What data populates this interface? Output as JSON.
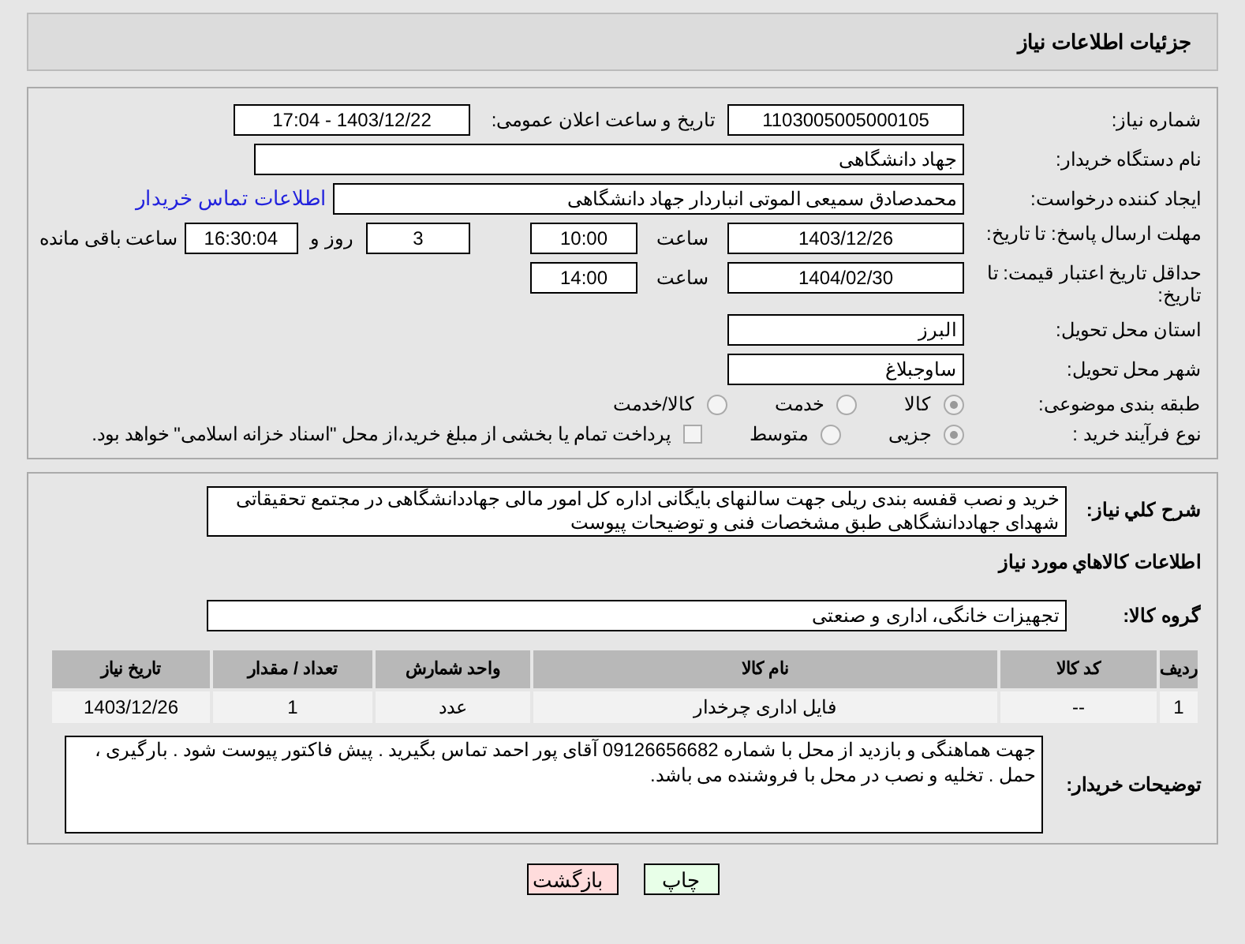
{
  "header": {
    "title": "جزئیات اطلاعات نیاز"
  },
  "need_number": {
    "label": "شماره نیاز:",
    "value": "1103005005000105"
  },
  "announce": {
    "label": "تاریخ و ساعت اعلان عمومی:",
    "value": "1403/12/22 - 17:04"
  },
  "buyer_org": {
    "label": "نام دستگاه خریدار:",
    "value": "جهاد دانشگاهی"
  },
  "requester": {
    "label": "ایجاد کننده درخواست:",
    "value": "محمدصادق سمیعی الموتی انباردار جهاد دانشگاهی",
    "link": "اطلاعات تماس خریدار"
  },
  "reply_deadline": {
    "label": "مهلت ارسال پاسخ: تا تاریخ:",
    "date": "1403/12/26",
    "time_label": "ساعت",
    "time": "10:00",
    "days": "3",
    "days_label": "روز و",
    "remaining": "16:30:04",
    "remaining_label": "ساعت باقی مانده"
  },
  "price_validity": {
    "label": "حداقل تاریخ اعتبار قیمت: تا تاریخ:",
    "date": "1404/02/30",
    "time_label": "ساعت",
    "time": "14:00"
  },
  "province": {
    "label": "استان محل تحویل:",
    "value": "البرز"
  },
  "city": {
    "label": "شهر محل تحویل:",
    "value": "ساوجبلاغ"
  },
  "category": {
    "label": "طبقه بندی موضوعی:",
    "options": [
      {
        "label": "کالا",
        "selected": true
      },
      {
        "label": "خدمت",
        "selected": false
      },
      {
        "label": "کالا/خدمت",
        "selected": false
      }
    ]
  },
  "process": {
    "label": "نوع فرآیند خرید :",
    "options": [
      {
        "label": "جزیی",
        "selected": true
      },
      {
        "label": "متوسط",
        "selected": false
      }
    ],
    "treasury": {
      "label": "پرداخت تمام یا بخشی از مبلغ خرید،از محل \"اسناد خزانه اسلامی\" خواهد بود.",
      "checked": false
    }
  },
  "description": {
    "label": "شرح کلي نیاز:",
    "value": "خرید و نصب قفسه بندی ریلی جهت سالنهای بایگانی اداره کل امور مالی جهاددانشگاهی در مجتمع تحقیقاتی شهدای جهاددانشگاهی طبق مشخصات فنی و توضیحات پیوست"
  },
  "goods_heading": "اطلاعات کالاهاي مورد نیاز",
  "goods_group": {
    "label": "گروه کالا:",
    "value": "تجهیزات خانگی، اداری و صنعتی"
  },
  "table": {
    "columns": [
      "ردیف",
      "کد کالا",
      "نام کالا",
      "واحد شمارش",
      "تعداد / مقدار",
      "تاریخ نیاز"
    ],
    "rows": [
      [
        "1",
        "--",
        "فایل اداری چرخدار",
        "عدد",
        "1",
        "1403/12/26"
      ]
    ]
  },
  "buyer_notes": {
    "label": "توضیحات خریدار:",
    "value": "جهت هماهنگی و بازدید از محل با شماره 09126656682 آقای پور احمد تماس بگیرید . پیش فاکتور  پیوست شود . بارگیری ، حمل . تخلیه و نصب در محل با فروشنده می باشد."
  },
  "buttons": [
    {
      "label": "چاپ",
      "kind": "print"
    },
    {
      "label": "بازگشت",
      "kind": "back"
    }
  ]
}
